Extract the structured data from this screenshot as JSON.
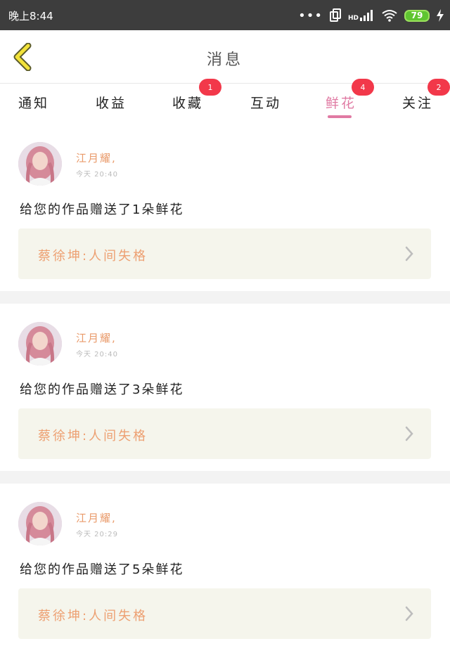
{
  "status_bar": {
    "time": "晚上8:44",
    "signal_label": "HD",
    "battery": "79"
  },
  "header": {
    "title": "消息",
    "back_icon": "chevron-left-icon"
  },
  "tabs": [
    {
      "label": "通知",
      "badge": ""
    },
    {
      "label": "收益",
      "badge": ""
    },
    {
      "label": "收藏",
      "badge": "1"
    },
    {
      "label": "互动",
      "badge": ""
    },
    {
      "label": "鲜花",
      "badge": "4",
      "active": true
    },
    {
      "label": "关注",
      "badge": "2"
    }
  ],
  "colors": {
    "accent": "#e07aa3",
    "badge": "#f2384a",
    "name": "#e99a6a",
    "work_text": "#eda072",
    "work_bg": "#f5f5ec"
  },
  "messages": [
    {
      "sender": "江月耀,",
      "time": "今天 20:40",
      "text": "给您的作品赠送了1朵鲜花",
      "work": "蔡徐坤:人间失格"
    },
    {
      "sender": "江月耀,",
      "time": "今天 20:40",
      "text": "给您的作品赠送了3朵鲜花",
      "work": "蔡徐坤:人间失格"
    },
    {
      "sender": "江月耀,",
      "time": "今天 20:29",
      "text": "给您的作品赠送了5朵鲜花",
      "work": "蔡徐坤:人间失格"
    }
  ]
}
